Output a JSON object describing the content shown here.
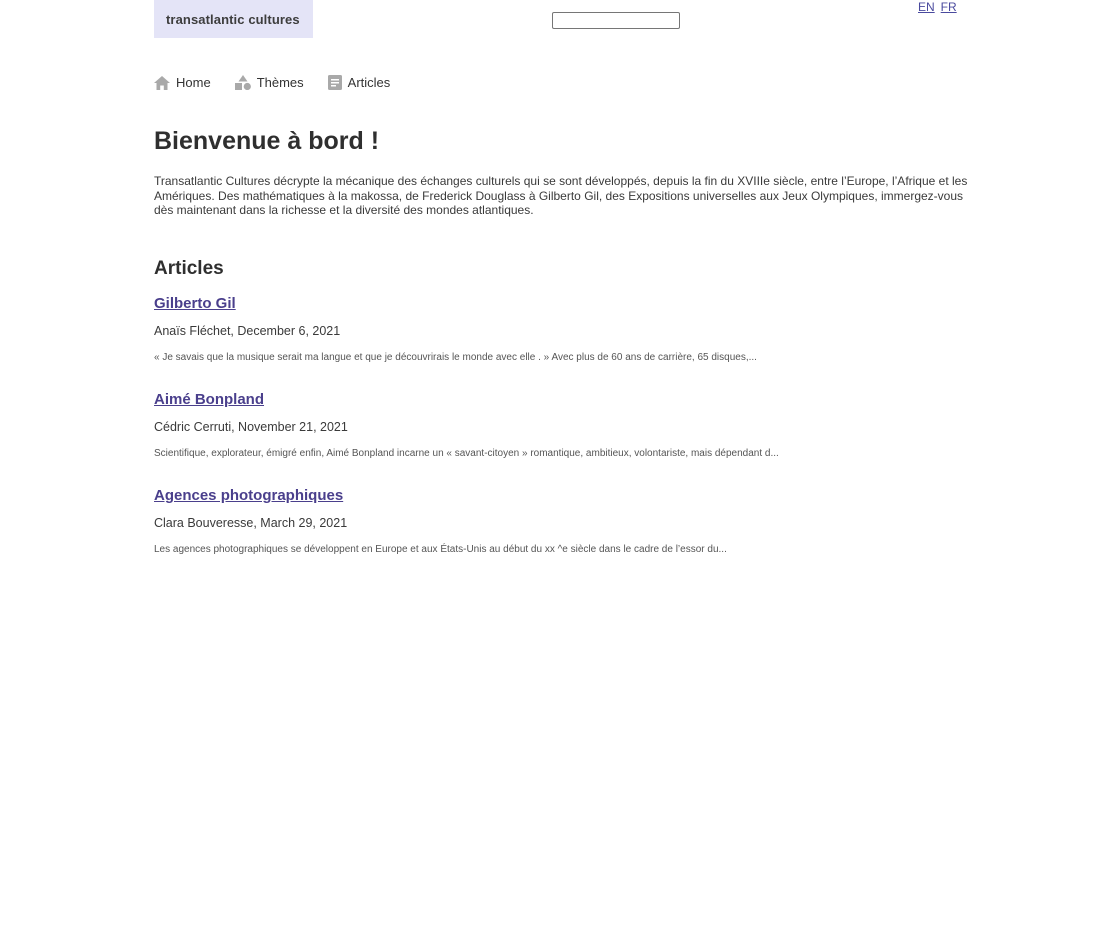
{
  "header": {
    "logo_text": "transatlantic cultures",
    "search": {
      "value": "",
      "placeholder": ""
    },
    "languages": [
      "EN",
      "FR"
    ]
  },
  "nav": {
    "items": [
      {
        "label": "Home",
        "icon": "home-icon"
      },
      {
        "label": "Thèmes",
        "icon": "shapes-icon"
      },
      {
        "label": "Articles",
        "icon": "document-icon"
      }
    ]
  },
  "main": {
    "title": "Bienvenue à bord !",
    "intro": "Transatlantic Cultures décrypte la mécanique des échanges culturels qui se sont développés, depuis la fin du XVIIIe siècle, entre l’Europe, l’Afrique et les Amériques. Des mathématiques à la makossa, de Frederick Douglass à Gilberto Gil, des Expositions universelles aux Jeux Olympiques, immergez-vous dès maintenant dans la richesse et la diversité des mondes atlantiques.",
    "articles_heading": "Articles",
    "articles": [
      {
        "title": "Gilberto Gil",
        "meta": "Anaïs Fléchet, December 6, 2021",
        "excerpt": "«  Je savais que la musique serait ma langue et que je découvrirais le monde avec elle . » Avec plus de 60 ans de carrière, 65 disques,..."
      },
      {
        "title": "Aimé Bonpland",
        "meta": "Cédric Cerruti, November 21, 2021",
        "excerpt": "Scientifique, explorateur, émigré enfin, Aimé Bonpland incarne un « savant-citoyen » romantique, ambitieux, volontariste, mais dépendant d..."
      },
      {
        "title": "Agences photographiques",
        "meta": "Clara Bouveresse, March 29, 2021",
        "excerpt": "Les agences photographiques se développent en Europe et aux États-Unis au début du xx ^e siècle dans le cadre de l’essor du..."
      }
    ]
  },
  "colors": {
    "logo_bg": "#e4e4f7",
    "link": "#4a3f8c",
    "icon": "#a9a9a9",
    "text": "#333333"
  }
}
